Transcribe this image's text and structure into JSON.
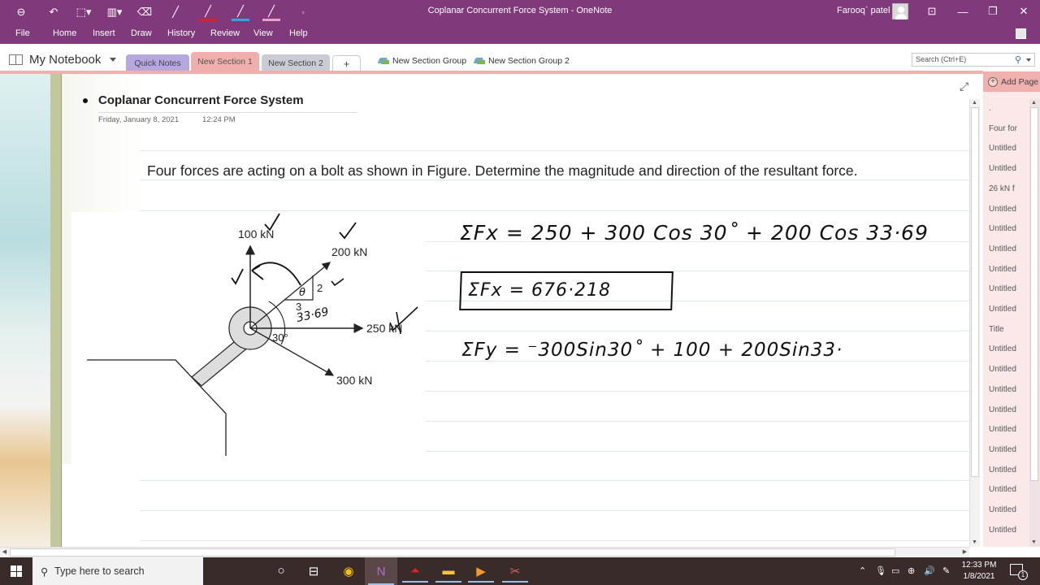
{
  "window": {
    "title": "Coplanar Concurrent Force System  -  OneNote",
    "user_name": "Farooq` patel"
  },
  "quick_access": [
    {
      "name": "back-icon",
      "glyph": "⊖"
    },
    {
      "name": "undo-icon",
      "glyph": "↶"
    },
    {
      "name": "lasso-select-icon",
      "glyph": "⬚"
    },
    {
      "name": "pen-holder-icon",
      "glyph": "▥"
    },
    {
      "name": "eraser-icon",
      "glyph": "⌫"
    },
    {
      "name": "pen-black-icon",
      "glyph": "╱"
    },
    {
      "name": "pen-red-icon",
      "glyph": "╱"
    },
    {
      "name": "pen-blue-icon",
      "glyph": "╱"
    },
    {
      "name": "highlighter-pink-icon",
      "glyph": "╱"
    },
    {
      "name": "customize-qat-icon",
      "glyph": "▫"
    }
  ],
  "window_controls": {
    "ribbon_display": "⊡",
    "minimize": "—",
    "restore": "❐",
    "close": "✕"
  },
  "ribbon": {
    "tabs": [
      "File",
      "Home",
      "Insert",
      "Draw",
      "History",
      "Review",
      "View",
      "Help"
    ]
  },
  "notebook": {
    "name": "My Notebook",
    "sections": [
      "Quick Notes",
      "New Section 1",
      "New Section 2"
    ],
    "active_section": "New Section 1",
    "add_section": "+",
    "section_groups": [
      "New Section Group",
      "New Section Group 2"
    ],
    "search_placeholder": "Search (Ctrl+E)"
  },
  "page": {
    "title": "Coplanar Concurrent Force System",
    "date": "Friday, January 8, 2021",
    "time": "12:24 PM",
    "problem": "Four forces are acting on a bolt as shown in Figure. Determine the magnitude and direction of the resultant force.",
    "figure": {
      "forces": [
        "100 kN",
        "200 kN",
        "250 kN",
        "300 kN"
      ],
      "slope_rise": "2",
      "slope_run": "3",
      "angle_label": "30°",
      "theta_label": "θ",
      "ink_angle": "33·69"
    },
    "ink": {
      "eq_sum_fx": "ΣFx  =  250 + 300 Cos 30˚ + 200 Cos 33·69",
      "eq_sum_fx_result": "ΣFx  =    676·218",
      "eq_sum_fy": "ΣFy =   ⁻300Sin30˚ + 100  + 200Sin33·"
    }
  },
  "pages_panel": {
    "add_page": "Add Page",
    "items": [
      ".",
      "Four for",
      "Untitled",
      "Untitled",
      "26 kN f",
      "Untitled",
      "Untitled",
      "Untitled",
      "Untitled",
      "Untitled",
      "Untitled",
      "Title",
      "Untitled",
      "Untitled",
      "Untitled",
      "Untitled",
      "Untitled",
      "Untitled",
      "Untitled",
      "Untitled",
      "Untitled",
      "Untitled"
    ]
  },
  "taskbar": {
    "search_placeholder": "Type here to search",
    "time": "12:33 PM",
    "date": "1/8/2021",
    "notification_count": "1"
  }
}
